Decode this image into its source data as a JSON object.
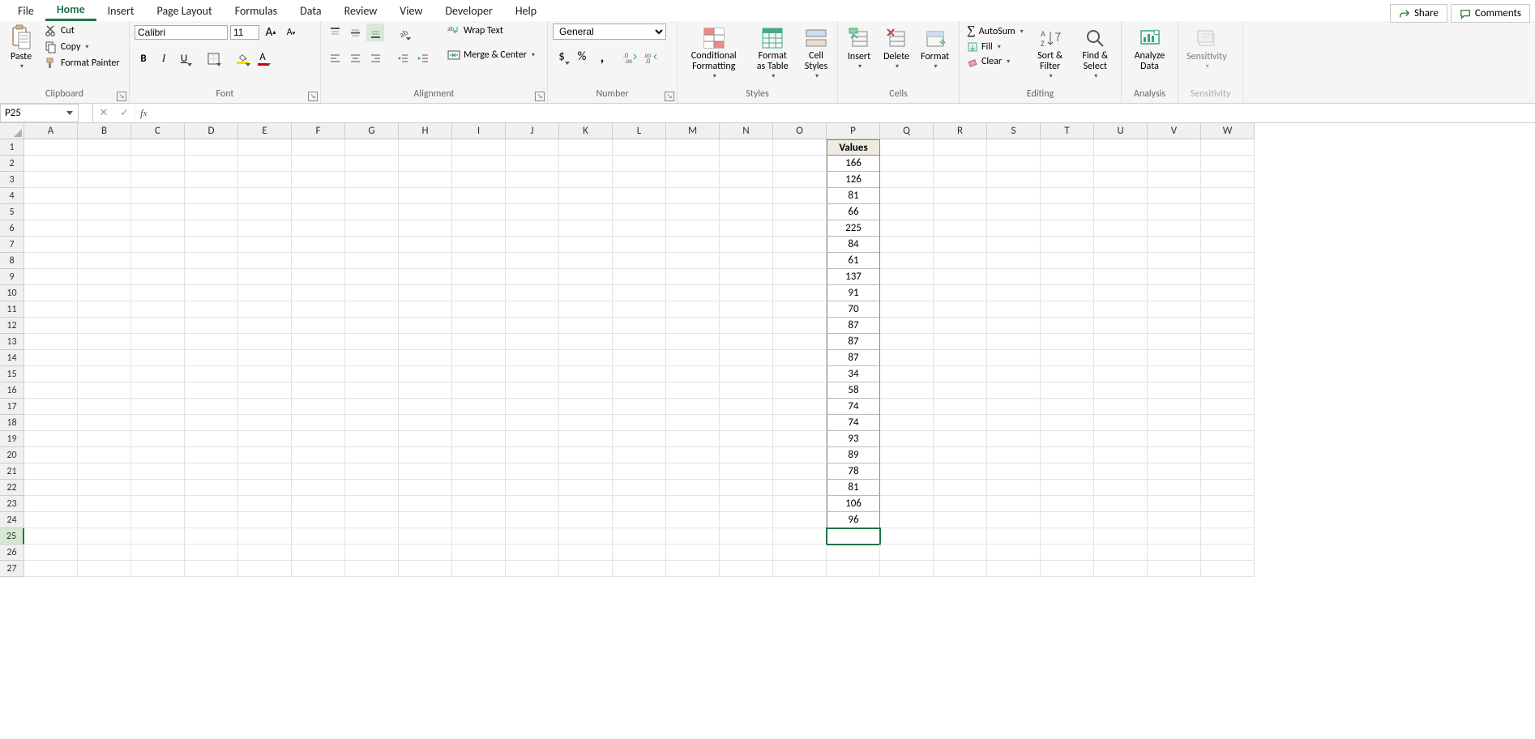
{
  "topRight": {
    "share": "Share",
    "comments": "Comments"
  },
  "tabs": [
    "File",
    "Home",
    "Insert",
    "Page Layout",
    "Formulas",
    "Data",
    "Review",
    "View",
    "Developer",
    "Help"
  ],
  "activeTab": "Home",
  "clipboard": {
    "group": "Clipboard",
    "paste": "Paste",
    "cut": "Cut",
    "copy": "Copy",
    "formatPainter": "Format Painter"
  },
  "font": {
    "group": "Font",
    "name": "Calibri",
    "size": "11"
  },
  "alignment": {
    "group": "Alignment",
    "wrap": "Wrap Text",
    "merge": "Merge & Center"
  },
  "number": {
    "group": "Number",
    "format": "General"
  },
  "styles": {
    "group": "Styles",
    "cond": "Conditional Formatting",
    "fmtTable": "Format as Table",
    "cellStyles": "Cell Styles"
  },
  "cells": {
    "group": "Cells",
    "insert": "Insert",
    "delete": "Delete",
    "format": "Format"
  },
  "editing": {
    "group": "Editing",
    "autosum": "AutoSum",
    "fill": "Fill",
    "clear": "Clear",
    "sortFilter": "Sort & Filter",
    "findSelect": "Find & Select"
  },
  "analysis": {
    "group": "Analysis",
    "analyze": "Analyze Data"
  },
  "sensitivity": {
    "group": "Sensitivity",
    "label": "Sensitivity"
  },
  "nameBox": "P25",
  "formula": "",
  "columns": [
    "A",
    "B",
    "C",
    "D",
    "E",
    "F",
    "G",
    "H",
    "I",
    "J",
    "K",
    "L",
    "M",
    "N",
    "O",
    "P",
    "Q",
    "R",
    "S",
    "T",
    "U",
    "V",
    "W"
  ],
  "rowCount": 27,
  "activeRow": 25,
  "activeCol": 15,
  "dataCol": 15,
  "dataHeader": "Values",
  "dataValues": [
    166,
    126,
    81,
    66,
    225,
    84,
    61,
    137,
    91,
    70,
    87,
    87,
    87,
    34,
    58,
    74,
    74,
    93,
    89,
    78,
    81,
    106,
    96
  ]
}
